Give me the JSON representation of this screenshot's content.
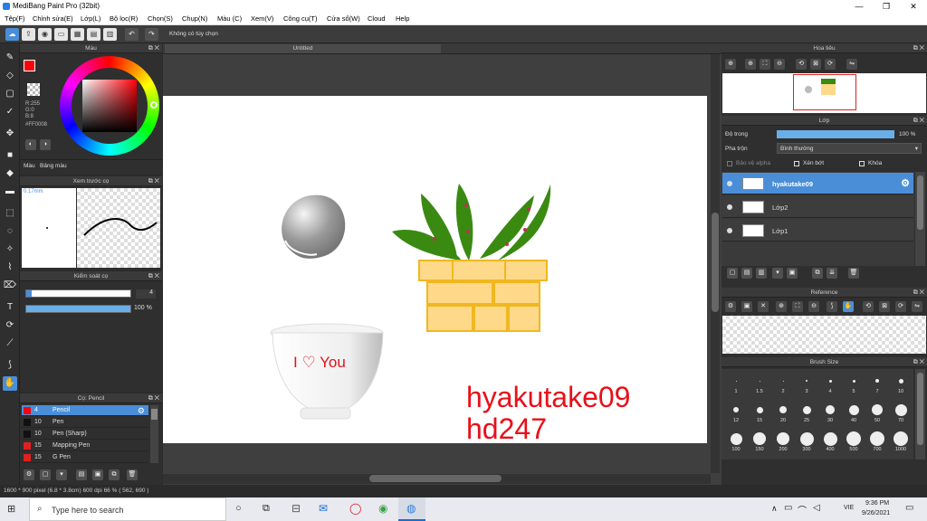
{
  "window": {
    "title": "MediBang Paint Pro (32bit)"
  },
  "menu": [
    "Tệp(F)",
    "Chỉnh sửa(E)",
    "Lớp(L)",
    "Bộ lọc(R)",
    "Chọn(S)",
    "Chụp(N)",
    "Màu (C)",
    "Xem(V)",
    "Công cụ(T)",
    "Cửa sổ(W)",
    "Cloud",
    "Help"
  ],
  "toolbar": {
    "hint": "Không có tùy chọn"
  },
  "color_panel": {
    "title": "Màu",
    "rgb_r": "R:255",
    "rgb_g": "G:0",
    "rgb_b": "B:8",
    "hex": "#FF0008",
    "tab_color": "Màu",
    "tab_palette": "Bảng màu"
  },
  "brush_preview": {
    "title": "Xem trước cọ",
    "size_label": "0.17mm"
  },
  "brush_control": {
    "title": "Kiểm soát cọ",
    "size_value": "4",
    "opacity_value": "100 %",
    "size_fraction": 0.05,
    "opacity_fraction": 1.0
  },
  "brush_list": {
    "title": "Cọ: Pencil",
    "items": [
      {
        "size": "4",
        "name": "Pencil",
        "color": "#ff0008"
      },
      {
        "size": "10",
        "name": "Pen",
        "color": "#111111"
      },
      {
        "size": "10",
        "name": "Pen (Sharp)",
        "color": "#111111"
      },
      {
        "size": "15",
        "name": "Mapping Pen",
        "color": "#e02020"
      },
      {
        "size": "15",
        "name": "G Pen",
        "color": "#e02020"
      }
    ]
  },
  "canvas": {
    "tab_title": "Untitled",
    "text_line1": "hyakutake09",
    "text_line2": "hd247",
    "cup_text": "I ♡ You"
  },
  "navigator": {
    "title": "Hoa tiêu"
  },
  "layers": {
    "title": "Lớp",
    "opacity_label": "Độ trong",
    "opacity_value": "100 %",
    "opacity_fraction": 1.0,
    "blend_label": "Pha trộn",
    "blend_value": "Bình thường",
    "protect_alpha": "Bảo vệ alpha",
    "clipping": "Xén bớt",
    "lock": "Khóa",
    "items": [
      {
        "name": "hyakutake09",
        "selected": true
      },
      {
        "name": "Lớp2",
        "selected": false
      },
      {
        "name": "Lớp1",
        "selected": false
      }
    ]
  },
  "reference": {
    "title": "Reference"
  },
  "brush_size": {
    "title": "Brush Size",
    "sizes": [
      "1",
      "1.5",
      "2",
      "3",
      "4",
      "5",
      "7",
      "10",
      "12",
      "15",
      "20",
      "25",
      "30",
      "40",
      "50",
      "70",
      "100",
      "150",
      "200",
      "300",
      "400",
      "500",
      "700",
      "1000"
    ]
  },
  "status": {
    "text": "1600 * 900 pixel  (6.8 * 3.8cm)  600 dpi  66 %  ( 562, 690 )"
  },
  "taskbar": {
    "search_placeholder": "Type here to search",
    "time": "9:36 PM",
    "date": "9/26/2021",
    "lang": "VIE"
  }
}
